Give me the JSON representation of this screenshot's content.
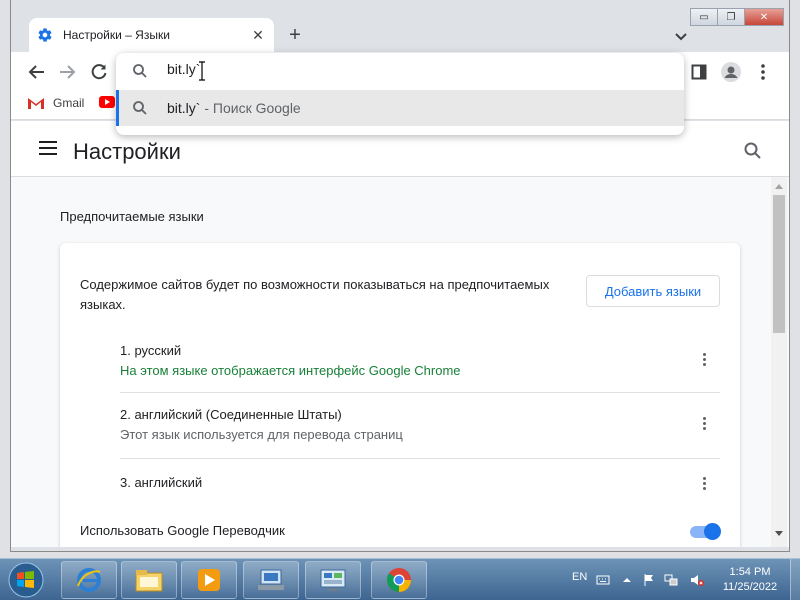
{
  "browser": {
    "tab": {
      "title": "Настройки – Языки",
      "icon": "gear-icon",
      "close": "✕"
    },
    "new_tab_label": "+",
    "window_controls": {
      "minimize": "▭",
      "restore": "❐",
      "close": "✕"
    },
    "omnibox": {
      "input_value": "bit.ly`",
      "suggestion": {
        "query": "bit.ly`",
        "suffix": " - Поиск Google"
      }
    },
    "bookmarks": [
      {
        "label": "Gmail",
        "icon": "gmail-icon"
      },
      {
        "label": "",
        "icon": "youtube-icon"
      }
    ]
  },
  "settings": {
    "title": "Настройки",
    "section_title": "Предпочитаемые языки",
    "card_description": "Содержимое сайтов будет по возможности показываться на предпочитаемых языках.",
    "add_languages_button": "Добавить языки",
    "languages": [
      {
        "name": "1. русский",
        "subtitle": "На этом языке отображается интерфейс Google Chrome",
        "subtitle_color": "#188038"
      },
      {
        "name": "2. английский (Соединенные Штаты)",
        "subtitle": "Этот язык используется для перевода страниц",
        "subtitle_color": "#5f6368"
      },
      {
        "name": "3. английский",
        "subtitle": "",
        "subtitle_color": "#5f6368"
      }
    ],
    "translate_label": "Использовать Google Переводчик",
    "translate_enabled": true
  },
  "taskbar": {
    "language": "EN",
    "time": "1:54 PM",
    "date": "11/25/2022",
    "apps": [
      "internet-explorer-icon",
      "file-explorer-icon",
      "media-player-icon",
      "network-icon",
      "control-panel-icon",
      "chrome-icon"
    ]
  },
  "colors": {
    "accent": "#1a73e8",
    "link_green": "#188038",
    "taskbar": "#3d6591"
  }
}
